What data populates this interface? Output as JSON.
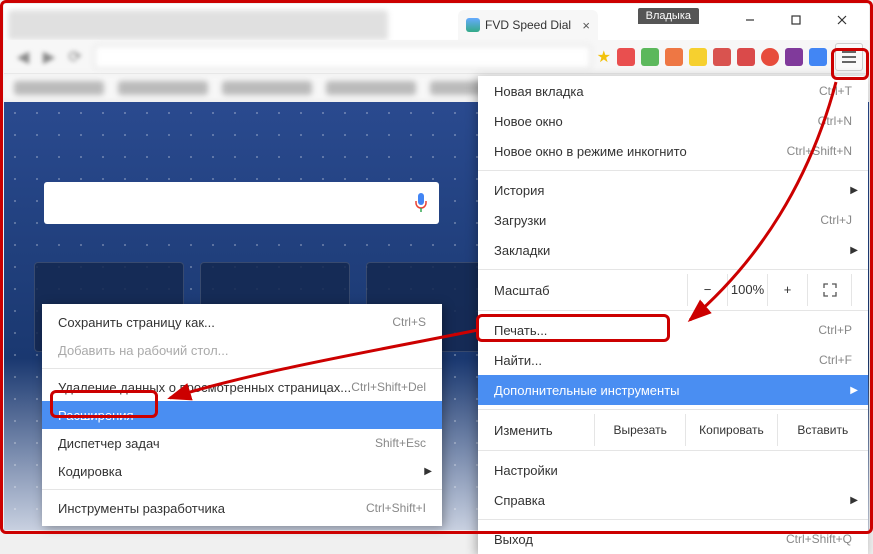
{
  "user_badge": "Владыка",
  "tab": {
    "title": "FVD Speed Dial"
  },
  "menu": {
    "new_tab": {
      "label": "Новая вкладка",
      "shortcut": "Ctrl+T"
    },
    "new_window": {
      "label": "Новое окно",
      "shortcut": "Ctrl+N"
    },
    "incognito": {
      "label": "Новое окно в режиме инкогнито",
      "shortcut": "Ctrl+Shift+N"
    },
    "history": {
      "label": "История"
    },
    "downloads": {
      "label": "Загрузки",
      "shortcut": "Ctrl+J"
    },
    "bookmarks": {
      "label": "Закладки"
    },
    "zoom": {
      "label": "Масштаб",
      "minus": "−",
      "value": "100%",
      "plus": "+"
    },
    "print": {
      "label": "Печать...",
      "shortcut": "Ctrl+P"
    },
    "find": {
      "label": "Найти...",
      "shortcut": "Ctrl+F"
    },
    "more_tools": {
      "label": "Дополнительные инструменты"
    },
    "edit": {
      "label": "Изменить",
      "cut": "Вырезать",
      "copy": "Копировать",
      "paste": "Вставить"
    },
    "settings": {
      "label": "Настройки"
    },
    "help": {
      "label": "Справка"
    },
    "exit": {
      "label": "Выход",
      "shortcut": "Ctrl+Shift+Q"
    }
  },
  "submenu": {
    "save_as": {
      "label": "Сохранить страницу как...",
      "shortcut": "Ctrl+S"
    },
    "add_to_desktop": {
      "label": "Добавить на рабочий стол..."
    },
    "clear_data": {
      "label": "Удаление данных о просмотренных страницах...",
      "shortcut": "Ctrl+Shift+Del"
    },
    "extensions": {
      "label": "Расширения"
    },
    "task_manager": {
      "label": "Диспетчер задач",
      "shortcut": "Shift+Esc"
    },
    "encoding": {
      "label": "Кодировка"
    },
    "dev_tools": {
      "label": "Инструменты разработчика",
      "shortcut": "Ctrl+Shift+I"
    }
  }
}
